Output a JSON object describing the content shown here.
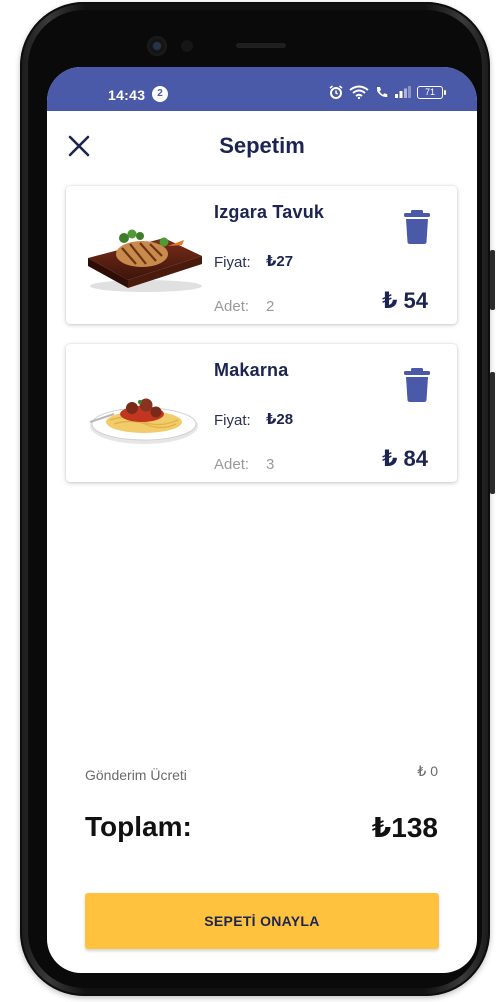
{
  "status": {
    "time": "14:43",
    "notification_count": "2",
    "battery": "71"
  },
  "header": {
    "title": "Sepetim"
  },
  "cart": {
    "price_label": "Fiyat:",
    "qty_label": "Adet:",
    "items": [
      {
        "name": "Izgara Tavuk",
        "price": "₺27",
        "qty": "2",
        "total": "₺ 54",
        "image": "grilled-chicken-image"
      },
      {
        "name": "Makarna",
        "price": "₺28",
        "qty": "3",
        "total": "₺ 84",
        "image": "spaghetti-image"
      }
    ]
  },
  "summary": {
    "shipping_label": "Gönderim Ücreti",
    "shipping_value": "₺ 0",
    "total_label": "Toplam:",
    "total_value": "₺138"
  },
  "actions": {
    "confirm_label": "SEPETİ ONAYLA"
  },
  "colors": {
    "status_bar": "#4a5aa8",
    "primary_text": "#1c2552",
    "trash_icon": "#4a5aa8",
    "confirm_button": "#fec23f"
  }
}
